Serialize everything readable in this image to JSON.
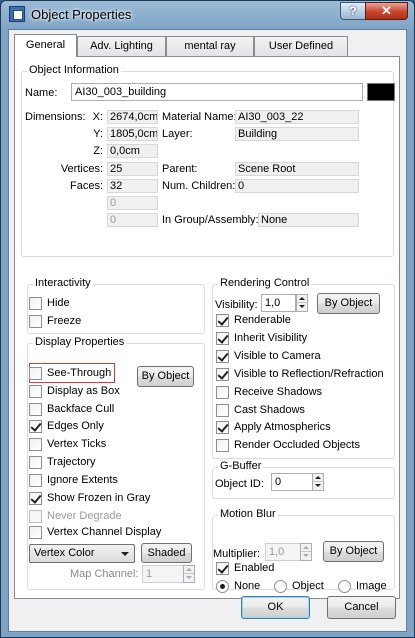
{
  "window": {
    "title": "Object Properties",
    "help": "?",
    "close": "✕"
  },
  "tabs": [
    "General",
    "Adv. Lighting",
    "mental ray",
    "User Defined"
  ],
  "object_info": {
    "group_label": "Object Information",
    "name_label": "Name:",
    "name_value": "AI30_003_building",
    "color": "#000000",
    "dimensions_label": "Dimensions:",
    "x_label": "X:",
    "x_value": "2674,0cm",
    "y_label": "Y:",
    "y_value": "1805,0cm",
    "z_label": "Z:",
    "z_value": "0,0cm",
    "vertices_label": "Vertices:",
    "vertices_value": "25",
    "faces_label": "Faces:",
    "faces_value": "32",
    "blank1": "0",
    "blank2": "0",
    "material_label": "Material Name:",
    "material_value": "AI30_003_22",
    "layer_label": "Layer:",
    "layer_value": "Building",
    "parent_label": "Parent:",
    "parent_value": "Scene Root",
    "children_label": "Num. Children:",
    "children_value": "0",
    "group_label2": "In Group/Assembly:",
    "group_value": "None"
  },
  "interactivity": {
    "group_label": "Interactivity",
    "hide": {
      "label": "Hide",
      "checked": false
    },
    "freeze": {
      "label": "Freeze",
      "checked": false
    }
  },
  "display": {
    "group_label": "Display Properties",
    "by_object": "By Object",
    "see_through": "See-Through",
    "display_as_box": "Display as Box",
    "backface_cull": "Backface Cull",
    "edges_only": "Edges Only",
    "vertex_ticks": "Vertex Ticks",
    "trajectory": "Trajectory",
    "ignore_extents": "Ignore Extents",
    "show_frozen_gray": "Show Frozen in Gray",
    "never_degrade": "Never Degrade",
    "vertex_channel_display": "Vertex Channel Display",
    "vertex_color": "Vertex Color",
    "shaded": "Shaded",
    "map_channel_label": "Map Channel:",
    "map_channel_value": "1"
  },
  "rendering": {
    "group_label": "Rendering Control",
    "visibility_label": "Visibility:",
    "visibility_value": "1,0",
    "by_object": "By Object",
    "renderable": "Renderable",
    "inherit_visibility": "Inherit Visibility",
    "visible_to_camera": "Visible to Camera",
    "visible_to_reflection": "Visible to Reflection/Refraction",
    "receive_shadows": "Receive Shadows",
    "cast_shadows": "Cast Shadows",
    "apply_atmospherics": "Apply Atmospherics",
    "render_occluded": "Render Occluded Objects"
  },
  "gbuffer": {
    "group_label": "G-Buffer",
    "object_id_label": "Object ID:",
    "object_id_value": "0"
  },
  "motion_blur": {
    "group_label": "Motion Blur",
    "multiplier_label": "Multiplier:",
    "multiplier_value": "1,0",
    "by_object": "By Object",
    "enabled": "Enabled",
    "none": "None",
    "object": "Object",
    "image": "Image"
  },
  "footer": {
    "ok": "OK",
    "cancel": "Cancel"
  }
}
